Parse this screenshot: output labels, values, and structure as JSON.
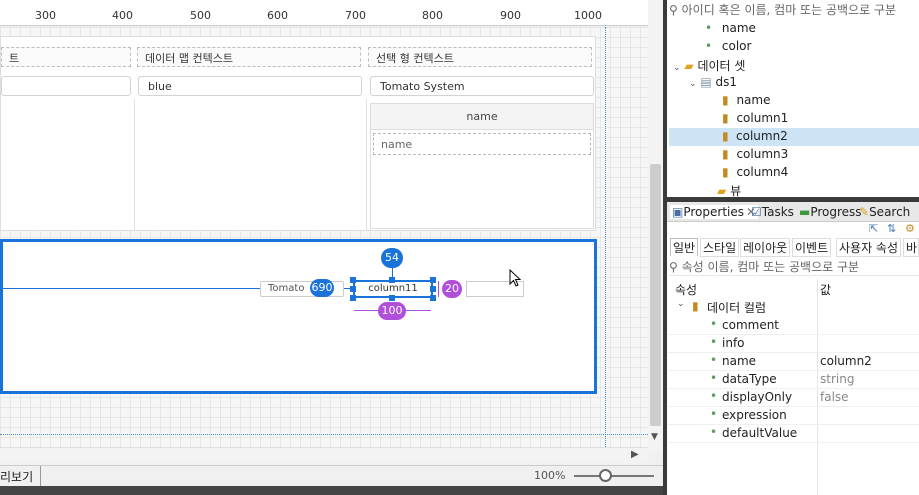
{
  "ruler": {
    "labels": [
      "300",
      "400",
      "500",
      "600",
      "700",
      "800",
      "900",
      "1000"
    ]
  },
  "form": {
    "headers": [
      "트",
      "데이터 맵 컨텍스트",
      "선택 형 컨텍스트"
    ],
    "inputs": [
      "blue",
      "Tomato System"
    ],
    "grid": {
      "header": "name",
      "cell": "name"
    }
  },
  "selection": {
    "top_badge": "54",
    "left_badge": "690",
    "right_badge": "20",
    "bottom_badge": "100",
    "selected_text": "column11",
    "left_text": "Tomato"
  },
  "bottom": {
    "tab_label": "리보기",
    "zoom": "100%"
  },
  "tree": {
    "search_placeholder": "아이디 혹은 이름, 컴마 또는 공백으로 구분",
    "items": [
      "name",
      "color",
      "데이터 셋",
      "ds1",
      "name",
      "column1",
      "column2",
      "column3",
      "column4",
      "뷰"
    ]
  },
  "props": {
    "tabs": [
      "Properties",
      "Tasks",
      "Progress",
      "Search"
    ],
    "subtabs": [
      "일반",
      "스타일",
      "레이아웃",
      "이벤트",
      "사용자 속성",
      "바인"
    ],
    "search_placeholder": "속성 이름, 컴마 또는 공백으로 구분",
    "col_attr": "속성",
    "col_value": "값",
    "group": "데이터 컬럼",
    "rows": [
      {
        "name": "comment",
        "value": ""
      },
      {
        "name": "info",
        "value": ""
      },
      {
        "name": "name",
        "value": "column2"
      },
      {
        "name": "dataType",
        "value": "string"
      },
      {
        "name": "displayOnly",
        "value": "false"
      },
      {
        "name": "expression",
        "value": ""
      },
      {
        "name": "defaultValue",
        "value": ""
      }
    ]
  },
  "colors": {
    "accent": "#1a73d8",
    "badge_purple": "#b04fd9",
    "selection_row": "#cde4f7"
  }
}
